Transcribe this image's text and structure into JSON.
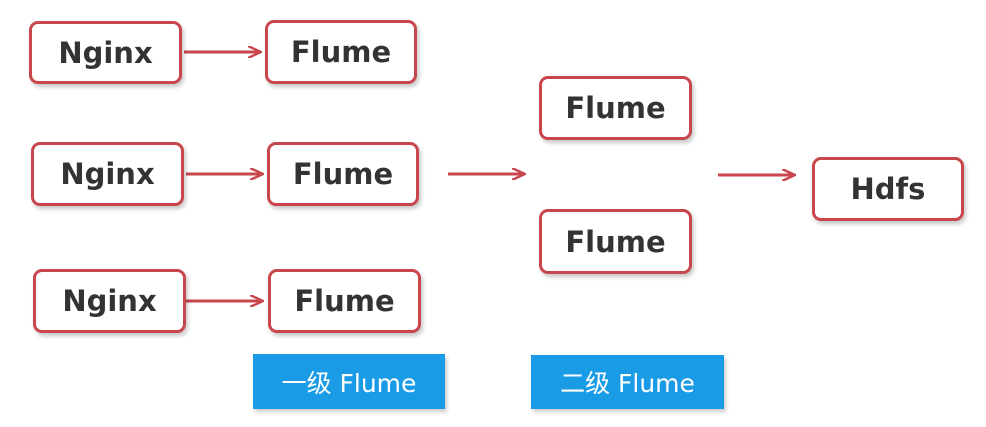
{
  "nodes": {
    "nginx_1": "Nginx",
    "nginx_2": "Nginx",
    "nginx_3": "Nginx",
    "flume_1_1": "Flume",
    "flume_1_2": "Flume",
    "flume_1_3": "Flume",
    "flume_2_1": "Flume",
    "flume_2_2": "Flume",
    "hdfs": "Hdfs"
  },
  "tier_labels": {
    "tier1": "一级 Flume",
    "tier2": "二级 Flume"
  },
  "colors": {
    "node_border": "#c8464c",
    "arrow": "#c8464c",
    "label_background": "#1a9be6",
    "label_text": "#ffffff"
  }
}
